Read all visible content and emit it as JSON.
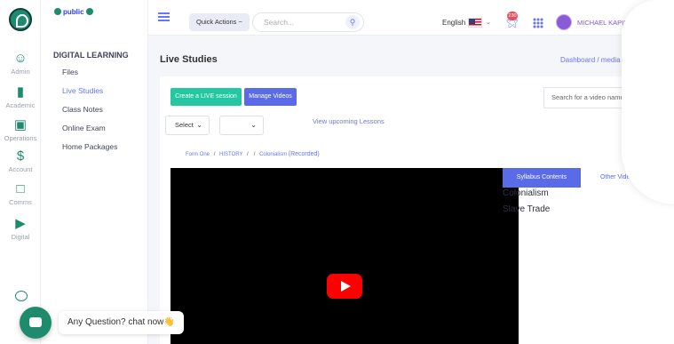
{
  "rail": {
    "items": [
      {
        "label": "Admin",
        "icon": "users-icon"
      },
      {
        "label": "Academic",
        "icon": "bar-chart-icon"
      },
      {
        "label": "Operations",
        "icon": "cube-icon"
      },
      {
        "label": "Account",
        "icon": "dollar-icon"
      },
      {
        "label": "Comms",
        "icon": "message-icon"
      },
      {
        "label": "Digital",
        "icon": "video-icon"
      }
    ]
  },
  "sidebar": {
    "public_label": "public",
    "section_title": "DIGITAL LEARNING",
    "items": [
      {
        "label": "Files"
      },
      {
        "label": "Live Studies"
      },
      {
        "label": "Class Notes"
      },
      {
        "label": "Online Exam"
      },
      {
        "label": "Home Packages"
      }
    ]
  },
  "topbar": {
    "quick_actions": "Quick Actions ~",
    "search_placeholder": "Search...",
    "language": "English",
    "notification_count": "230",
    "user_name": "MICHAEL KAPINGA ~"
  },
  "page": {
    "title": "Live Studies",
    "breadcrumb": "Dashboard  /  media  /  l"
  },
  "actions": {
    "create_live": "Create a LIVE session",
    "manage_videos": "Manage Videos",
    "video_search_placeholder": "Search for a video name ...",
    "select_label": "Select",
    "upcoming": "View upcoming Lessons"
  },
  "trail": {
    "form": "Form One",
    "subject": "HISTORY",
    "topic": "Colonialism",
    "status": "(Recorded)"
  },
  "panel": {
    "tab_syllabus": "Syllabus Contents",
    "tab_other": "Other Vide",
    "topics": [
      "Colonialism",
      "Slave Trade"
    ]
  },
  "chat": {
    "prompt": "Any Question? chat now👋"
  },
  "colors": {
    "brand": "#1e8a6e",
    "accent": "#5a6be8",
    "teal_button": "#23c8a1"
  }
}
